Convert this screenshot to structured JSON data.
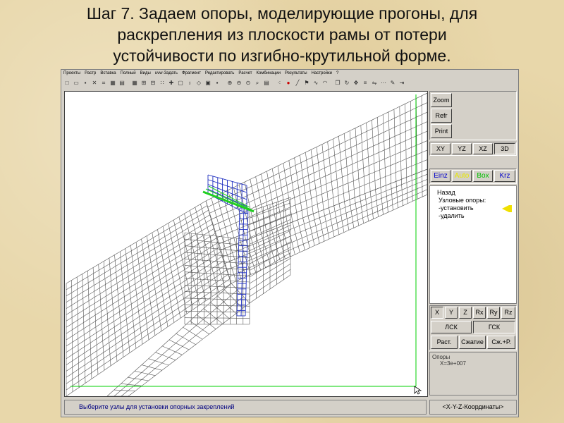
{
  "slide": {
    "title_line1": "Шаг 7. Задаем опоры, моделирующие прогоны, для",
    "title_line2": "раскрепления из плоскости рамы от потери",
    "title_line3": "устойчивости по изгибно-крутильной форме."
  },
  "menu": [
    "Проекты",
    "Растр",
    "Вставка",
    "Полный",
    "Виды",
    "uvw-Задать",
    "Фрагмент",
    "Редактировать",
    "Расчет",
    "Комбинации",
    "Результаты",
    "Настройки",
    "?"
  ],
  "panel": {
    "zoom": "Zoom",
    "refr": "Refr",
    "print": "Print",
    "views": [
      "XY",
      "YZ",
      "XZ",
      "3D"
    ],
    "modes": [
      "Einz",
      "Auto",
      "Box",
      "Krz"
    ],
    "mode_colors": [
      "#0000cc",
      "#e8e800",
      "#00c000",
      "#0000cc"
    ],
    "command": {
      "back": "Назад",
      "title": "Узловые опоры:",
      "install": "-установить",
      "remove": "-удалить"
    },
    "dofs": [
      "X",
      "Y",
      "Z",
      "Rx",
      "Ry",
      "Rz"
    ],
    "lsk": "ЛСК",
    "gsk": "ГСК",
    "rast": "Раст.",
    "szhatie": "Сжатие",
    "szh_r": "Сж.+Р.",
    "info_title": "Опоры",
    "info_value": "X=3e+007"
  },
  "status": {
    "hint": "Выберите узлы для установки опорных закреплений",
    "coords": "<X-Y-Z-Координаты>"
  },
  "colors": {
    "mesh": "#555555",
    "selected_nodes": "#2030c0",
    "supports": "#20d020",
    "marker": "#f0e000"
  }
}
